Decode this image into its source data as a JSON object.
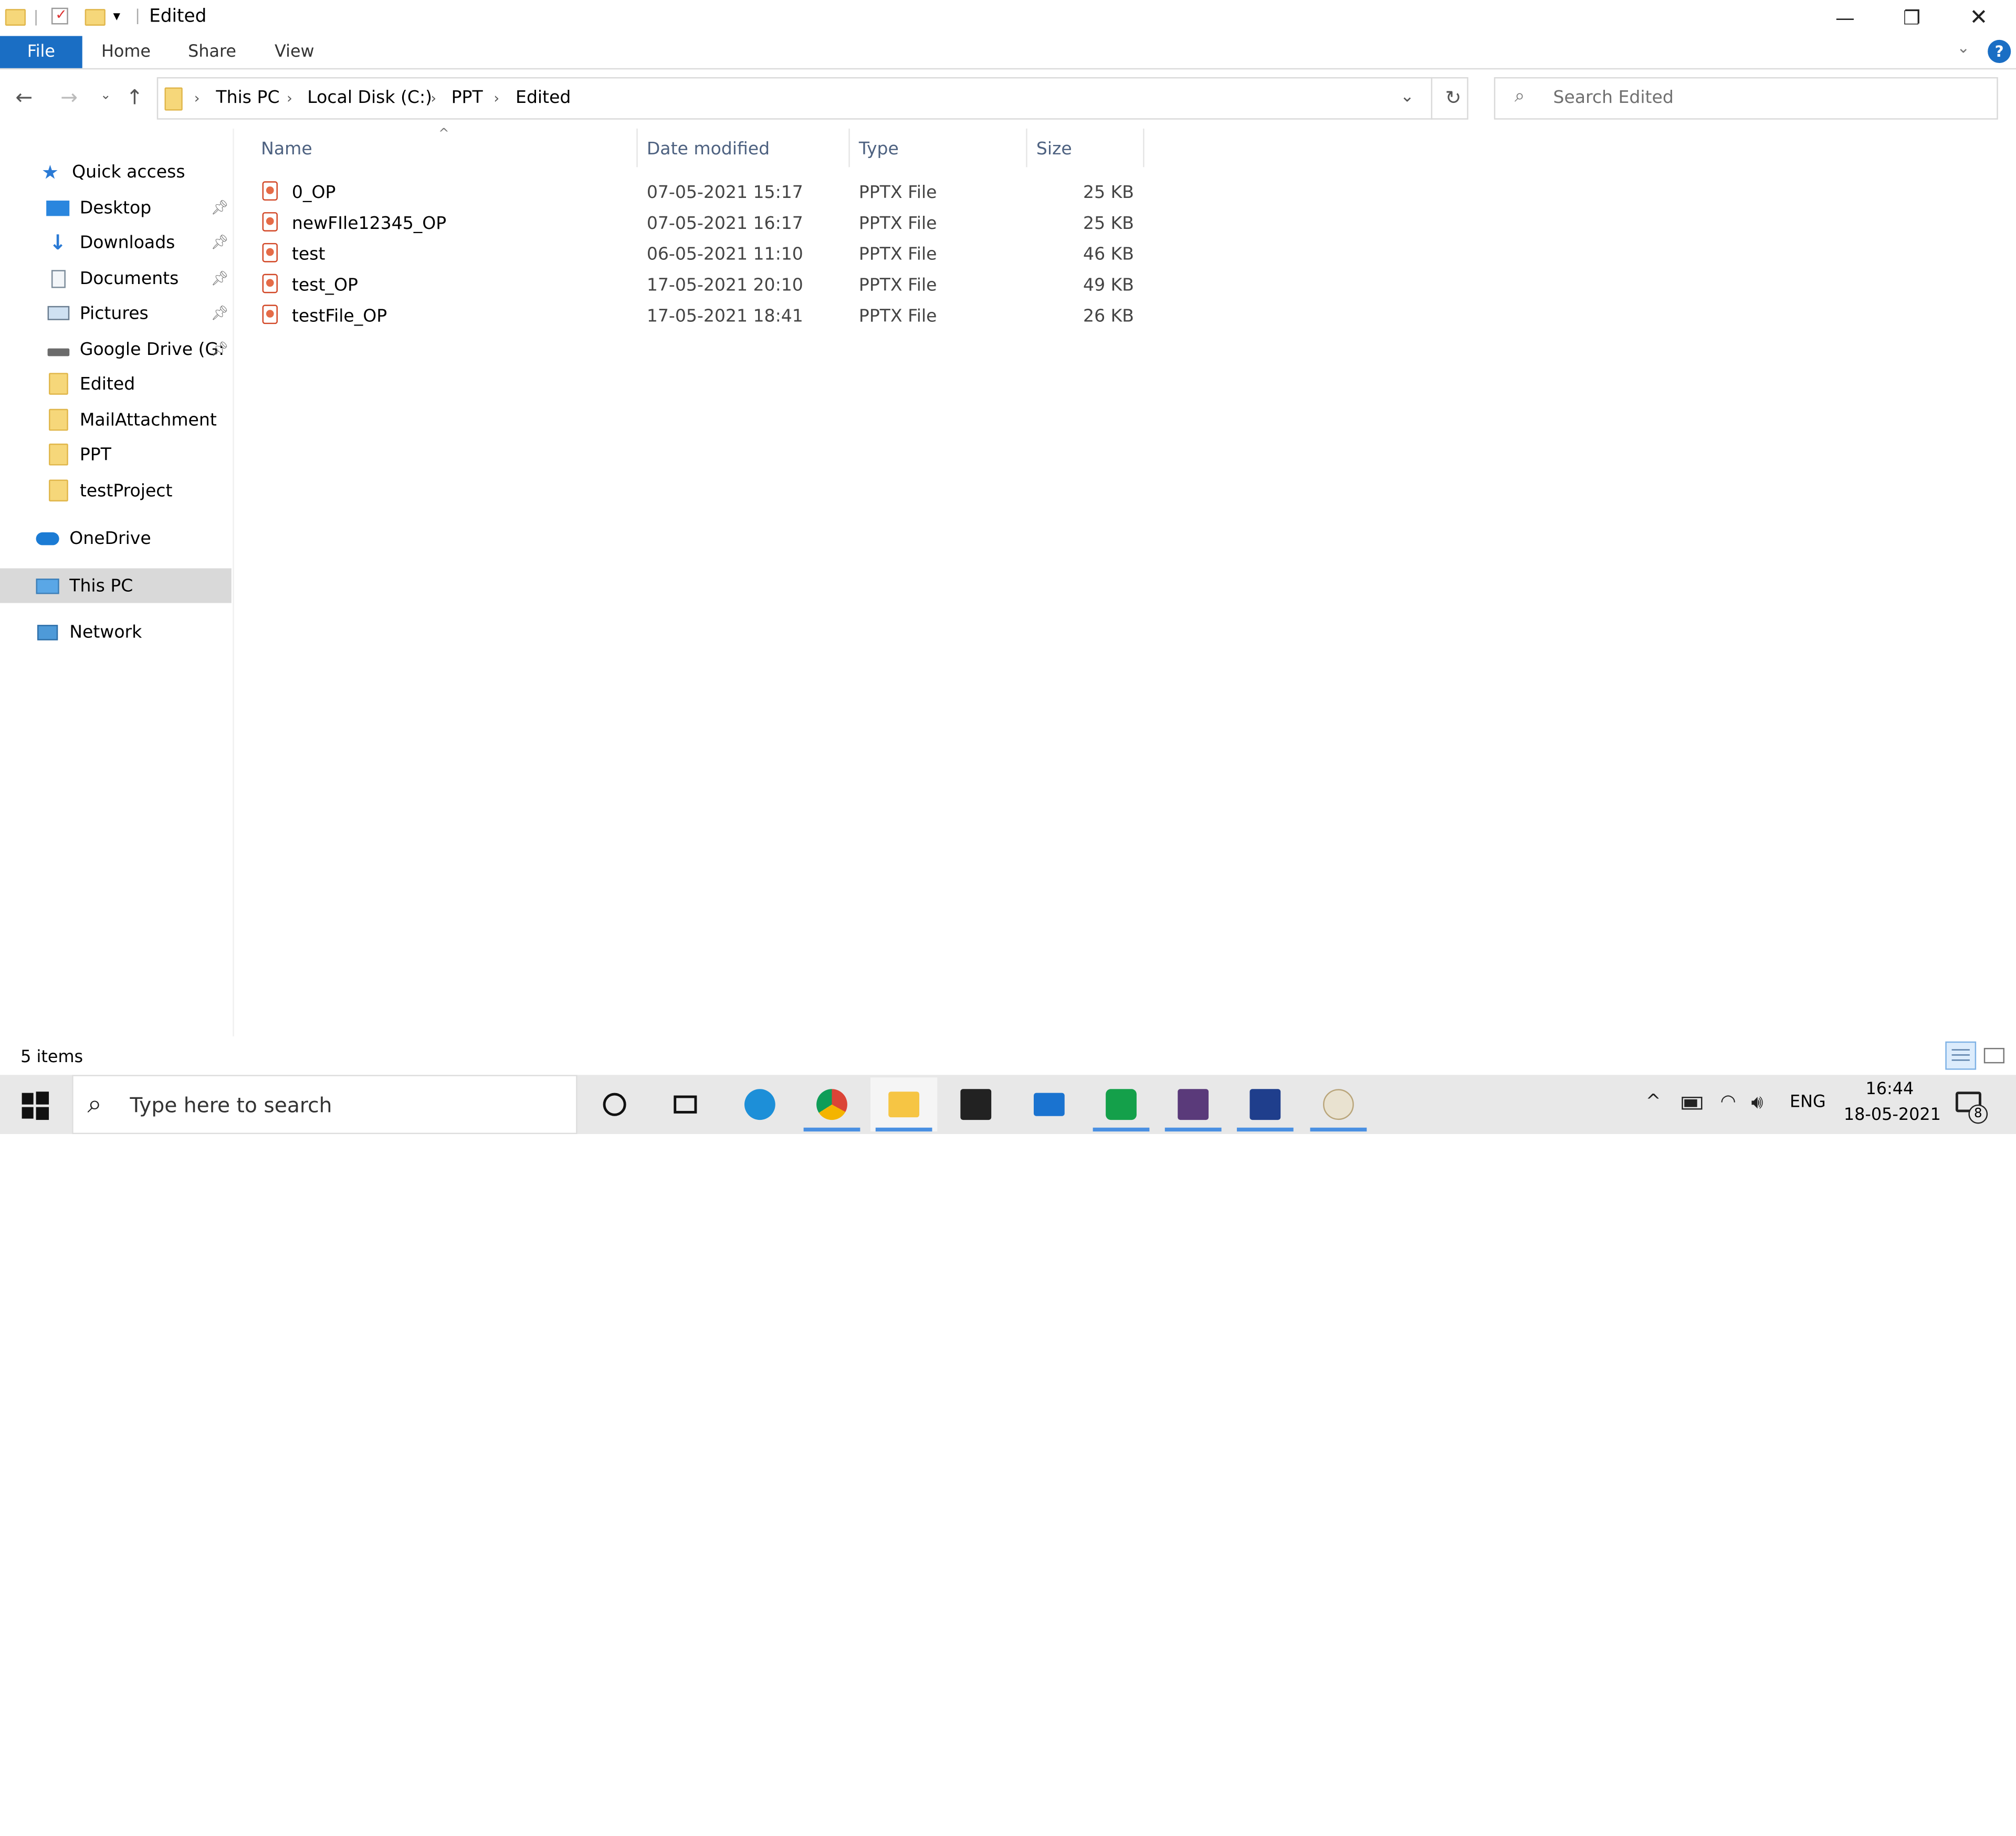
{
  "window": {
    "title": "Edited",
    "minimize_glyph": "—",
    "restore_glyph": "❐",
    "close_glyph": "✕"
  },
  "ribbon": {
    "tabs": [
      "File",
      "Home",
      "Share",
      "View"
    ],
    "help_glyph": "?"
  },
  "address": {
    "crumbs": [
      "This PC",
      "Local Disk (C:)",
      "PPT",
      "Edited"
    ],
    "search_placeholder": "Search Edited"
  },
  "nav": {
    "quick_access": "Quick access",
    "items": [
      {
        "label": "Desktop",
        "icon": "desktop-icon",
        "pinned": true
      },
      {
        "label": "Downloads",
        "icon": "downloads-icon",
        "pinned": true
      },
      {
        "label": "Documents",
        "icon": "documents-icon",
        "pinned": true
      },
      {
        "label": "Pictures",
        "icon": "pictures-icon",
        "pinned": true
      },
      {
        "label": "Google Drive (G:",
        "icon": "drive-icon",
        "pinned": true
      },
      {
        "label": "Edited",
        "icon": "folder-icon",
        "pinned": false
      },
      {
        "label": "MailAttachment",
        "icon": "folder-icon",
        "pinned": false
      },
      {
        "label": "PPT",
        "icon": "folder-icon",
        "pinned": false
      },
      {
        "label": "testProject",
        "icon": "folder-icon",
        "pinned": false
      }
    ],
    "onedrive": "OneDrive",
    "this_pc": "This PC",
    "network": "Network"
  },
  "list": {
    "columns": [
      "Name",
      "Date modified",
      "Type",
      "Size"
    ],
    "rows": [
      {
        "name": "0_OP",
        "date": "07-05-2021 15:17",
        "type": "PPTX File",
        "size": "25 KB"
      },
      {
        "name": "newFIle12345_OP",
        "date": "07-05-2021 16:17",
        "type": "PPTX File",
        "size": "25 KB"
      },
      {
        "name": "test",
        "date": "06-05-2021 11:10",
        "type": "PPTX File",
        "size": "46 KB"
      },
      {
        "name": "test_OP",
        "date": "17-05-2021 20:10",
        "type": "PPTX File",
        "size": "49 KB"
      },
      {
        "name": "testFile_OP",
        "date": "17-05-2021 18:41",
        "type": "PPTX File",
        "size": "26 KB"
      }
    ]
  },
  "status": {
    "item_count": "5 items"
  },
  "taskbar": {
    "search_placeholder": "Type here to search",
    "language": "ENG",
    "time": "16:44",
    "date": "18-05-2021",
    "notification_count": "8"
  },
  "colors": {
    "accent": "#1a6ec4",
    "taskbar_bg": "#e8e8e8",
    "selected_nav": "#d9d9d9"
  }
}
